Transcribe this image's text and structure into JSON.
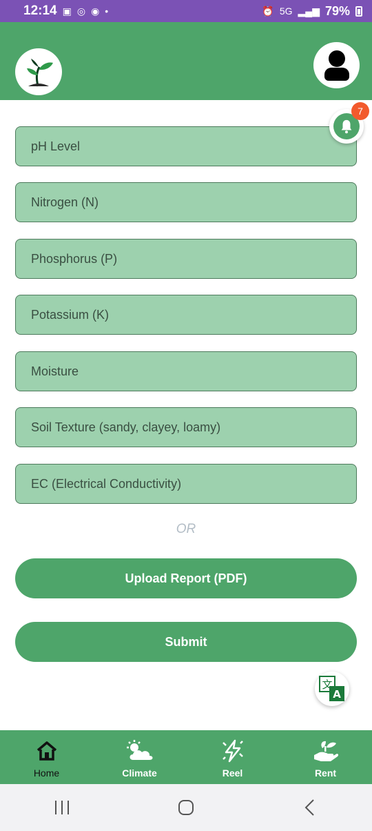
{
  "status_bar": {
    "time": "12:14",
    "battery": "79%",
    "network": "5G"
  },
  "notifications": {
    "count": "7"
  },
  "form": {
    "fields": [
      {
        "placeholder": "pH Level"
      },
      {
        "placeholder": "Nitrogen (N)"
      },
      {
        "placeholder": "Phosphorus (P)"
      },
      {
        "placeholder": "Potassium (K)"
      },
      {
        "placeholder": "Moisture"
      },
      {
        "placeholder": "Soil Texture (sandy, clayey, loamy)"
      },
      {
        "placeholder": "EC (Electrical Conductivity)"
      }
    ],
    "or_label": "OR",
    "upload_label": "Upload Report (PDF)",
    "submit_label": "Submit"
  },
  "bottom_nav": {
    "items": [
      {
        "label": "Home",
        "icon": "home-icon"
      },
      {
        "label": "Climate",
        "icon": "cloud-sun-icon"
      },
      {
        "label": "Reel",
        "icon": "lightning-icon"
      },
      {
        "label": "Rent",
        "icon": "hand-plant-icon"
      }
    ],
    "active": "Home"
  },
  "colors": {
    "primary": "#4ea56a",
    "field_bg": "#9dd1ae",
    "status_bar": "#7b52b5",
    "badge": "#f25a2c"
  }
}
